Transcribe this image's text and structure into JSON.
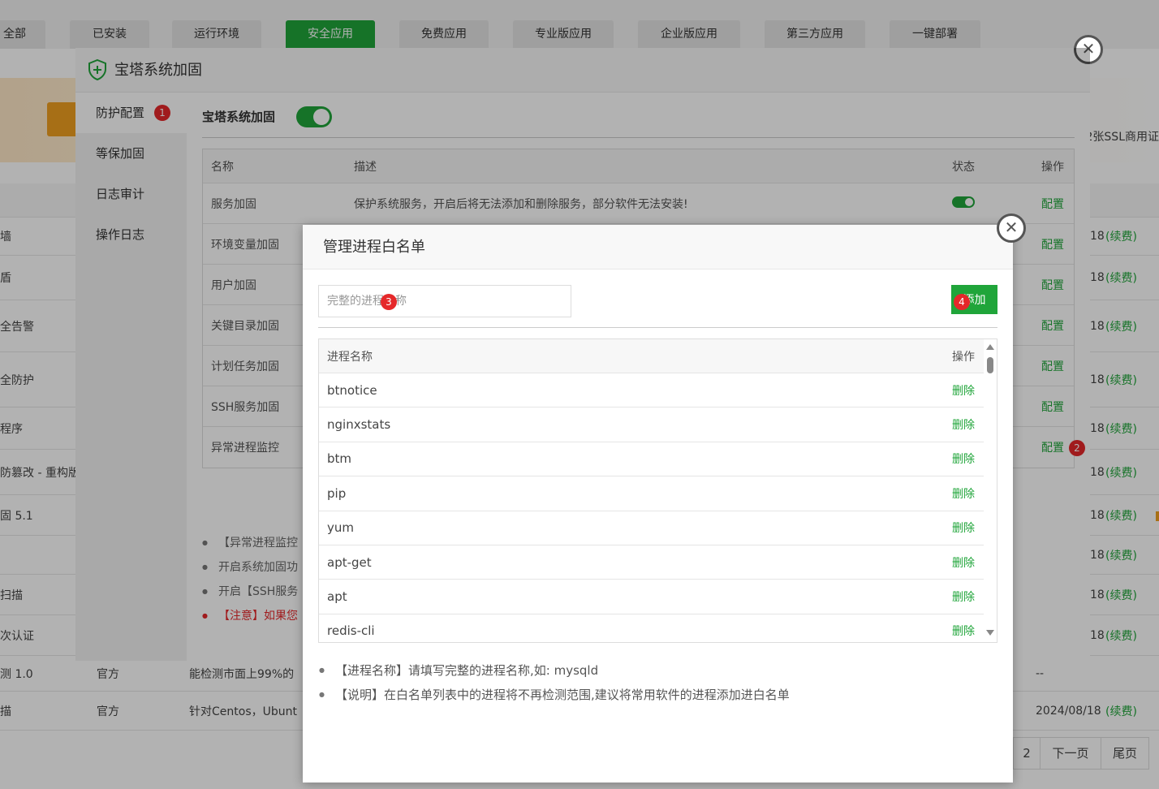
{
  "background": {
    "tabs": [
      {
        "label": "全部",
        "active": false
      },
      {
        "label": "已安装",
        "active": false
      },
      {
        "label": "运行环境",
        "active": false
      },
      {
        "label": "安全应用",
        "active": true
      },
      {
        "label": "免费应用",
        "active": false
      },
      {
        "label": "专业版应用",
        "active": false
      },
      {
        "label": "企业版应用",
        "active": false
      },
      {
        "label": "第三方应用",
        "active": false
      },
      {
        "label": "一键部署",
        "active": false
      }
    ],
    "banner_text": "2张SSL商用证",
    "rows": [
      {
        "name": "墙",
        "expire": "18",
        "renew": "(续费)"
      },
      {
        "name": "盾",
        "expire": "18",
        "renew": "(续费)"
      },
      {
        "name": "全告警",
        "expire": "18",
        "renew": "(续费)"
      },
      {
        "name": "全防护",
        "expire": "18",
        "renew": "(续费)"
      },
      {
        "name": "程序",
        "expire": "18",
        "renew": "(续费)"
      },
      {
        "name": "防篡改 - 重构版",
        "expire": "18",
        "renew": "(续费)"
      },
      {
        "name": "固 5.1",
        "expire": "18",
        "renew": "(续费)"
      },
      {
        "name": "",
        "expire": "18",
        "renew": "(续费)"
      },
      {
        "name": "扫描",
        "expire": "18",
        "renew": "(续费)"
      },
      {
        "name": "次认证",
        "expire": "18",
        "renew": "(续费)"
      }
    ],
    "row_detect": {
      "name": "测 1.0",
      "type": "官方",
      "desc": "能检测市面上99%的",
      "expire": "--"
    },
    "row_scan": {
      "name": "描",
      "type": "官方",
      "desc": "针对Centos，Ubunt",
      "expire": "2024/08/18",
      "renew": "(续费)"
    },
    "pager": {
      "page2": "2",
      "next": "下一页",
      "last": "尾页"
    }
  },
  "modal_main": {
    "title": "宝塔系统加固",
    "sidebar": [
      {
        "label": "防护配置",
        "badge": "1"
      },
      {
        "label": "等保加固"
      },
      {
        "label": "日志审计"
      },
      {
        "label": "操作日志"
      }
    ],
    "toggle_label": "宝塔系统加固",
    "table": {
      "headers": {
        "name": "名称",
        "desc": "描述",
        "status": "状态",
        "action": "操作"
      },
      "rows": [
        {
          "name": "服务加固",
          "desc": "保护系统服务，开启后将无法添加和删除服务，部分软件无法安装!",
          "action": "配置"
        },
        {
          "name": "环境变量加固",
          "action": "配置"
        },
        {
          "name": "用户加固",
          "action": "配置"
        },
        {
          "name": "关键目录加固",
          "action": "配置"
        },
        {
          "name": "计划任务加固",
          "action": "配置"
        },
        {
          "name": "SSH服务加固",
          "action": "配置"
        },
        {
          "name": "异常进程监控",
          "action": "配置",
          "badge": "2"
        }
      ]
    },
    "notes": [
      {
        "text": "【异常进程监控",
        "warn": false
      },
      {
        "text": "开启系统加固功",
        "warn": false
      },
      {
        "text": "开启【SSH服务",
        "warn": false
      },
      {
        "text": "【注意】如果您",
        "warn": true
      }
    ]
  },
  "modal_whitelist": {
    "title": "管理进程白名单",
    "input_placeholder": "完整的进程名称",
    "input_badge": "3",
    "add_label": "添加",
    "add_badge": "4",
    "headers": {
      "name": "进程名称",
      "action": "操作"
    },
    "processes": [
      "btnotice",
      "nginxstats",
      "btm",
      "pip",
      "yum",
      "apt-get",
      "apt",
      "redis-cli"
    ],
    "delete_label": "删除",
    "notes": [
      "【进程名称】请填写完整的进程名称,如: mysqld",
      "【说明】在白名单列表中的进程将不再检测范围,建议将常用软件的进程添加进白名单"
    ]
  }
}
